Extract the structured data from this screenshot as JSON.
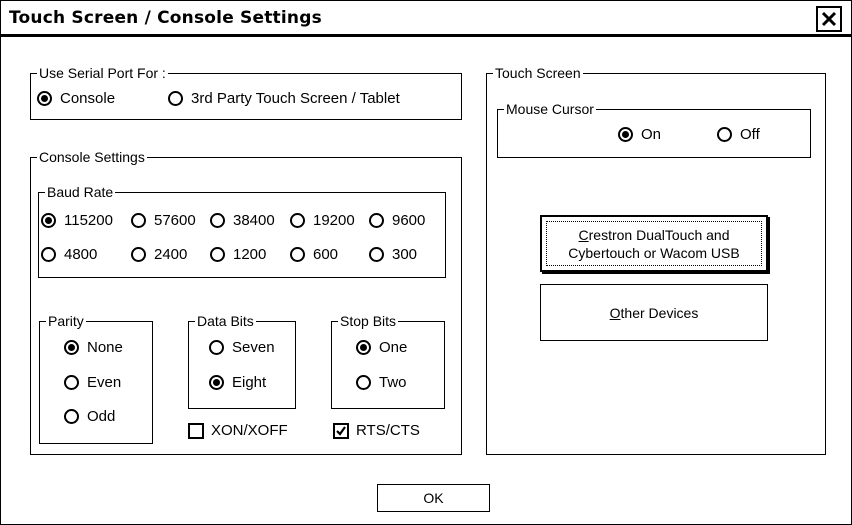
{
  "title": "Touch Screen / Console Settings",
  "serial_port": {
    "label": "Use Serial Port For :",
    "options": [
      {
        "label": "Console",
        "selected": true
      },
      {
        "label": "3rd Party Touch Screen / Tablet",
        "selected": false
      }
    ]
  },
  "console_settings": {
    "label": "Console Settings",
    "baud_rate": {
      "label": "Baud Rate",
      "options": [
        {
          "label": "115200",
          "selected": true
        },
        {
          "label": "57600",
          "selected": false
        },
        {
          "label": "38400",
          "selected": false
        },
        {
          "label": "19200",
          "selected": false
        },
        {
          "label": "9600",
          "selected": false
        },
        {
          "label": "4800",
          "selected": false
        },
        {
          "label": "2400",
          "selected": false
        },
        {
          "label": "1200",
          "selected": false
        },
        {
          "label": "600",
          "selected": false
        },
        {
          "label": "300",
          "selected": false
        }
      ]
    },
    "parity": {
      "label": "Parity",
      "options": [
        {
          "label": "None",
          "selected": true
        },
        {
          "label": "Even",
          "selected": false
        },
        {
          "label": "Odd",
          "selected": false
        }
      ]
    },
    "data_bits": {
      "label": "Data Bits",
      "options": [
        {
          "label": "Seven",
          "selected": false
        },
        {
          "label": "Eight",
          "selected": true
        }
      ]
    },
    "stop_bits": {
      "label": "Stop Bits",
      "options": [
        {
          "label": "One",
          "selected": true
        },
        {
          "label": "Two",
          "selected": false
        }
      ]
    },
    "xon_xoff": {
      "label": "XON/XOFF",
      "checked": false
    },
    "rts_cts": {
      "label": "RTS/CTS",
      "checked": true
    }
  },
  "touch_screen": {
    "label": "Touch Screen",
    "mouse_cursor": {
      "label": "Mouse Cursor",
      "options": [
        {
          "label": "On",
          "selected": true
        },
        {
          "label": "Off",
          "selected": false
        }
      ]
    },
    "crestron_button": {
      "mnemonic": "C",
      "line1_rest": "restron DualTouch and",
      "line2": "Cybertouch or Wacom USB"
    },
    "other_button": {
      "mnemonic": "O",
      "rest": "ther Devices"
    }
  },
  "ok_label": "OK"
}
